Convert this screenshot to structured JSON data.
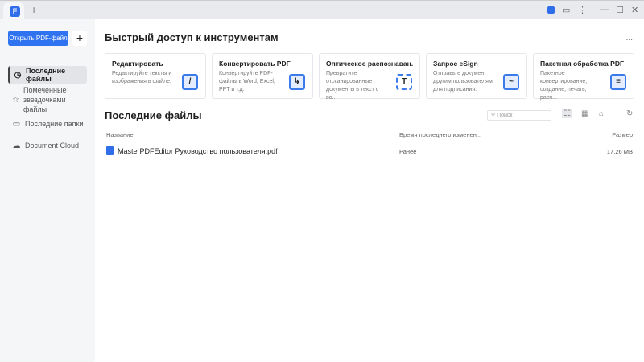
{
  "titlebar": {
    "plus": "+",
    "min": "—",
    "max": "☐",
    "close": "✕",
    "menu": "⋮"
  },
  "sidebar": {
    "open_button": "Открыть PDF-файл",
    "add": "+",
    "items": [
      {
        "label": "Последние файлы",
        "icon": "clock-icon"
      },
      {
        "label": "Помеченные звездочками файлы",
        "icon": "star-icon"
      },
      {
        "label": "Последние папки",
        "icon": "folder-icon"
      },
      {
        "label": "Document Cloud",
        "icon": "cloud-icon"
      }
    ]
  },
  "main": {
    "quick_title": "Быстрый доступ к инструментам",
    "more": "...",
    "cards": [
      {
        "title": "Редактировать",
        "desc": "Редактируйте тексты и изображения в файле."
      },
      {
        "title": "Конвертировать PDF",
        "desc": "Конвертируйте PDF-файлы в Word, Excel, PPT и т.д."
      },
      {
        "title": "Оптическое распознаван...",
        "desc": "Превратите отсканированные документы в текст с во..."
      },
      {
        "title": "Запрос eSign",
        "desc": "Отправьте документ другим пользователям для подписания."
      },
      {
        "title": "Пакетная обработка PDF",
        "desc": "Пакетное конвертирование, создание, печать, расп..."
      }
    ],
    "recent_title": "Последние файлы",
    "search_placeholder": "Поиск",
    "columns": {
      "name": "Название",
      "modified": "Время последнего изменен...",
      "size": "Размер"
    },
    "files": [
      {
        "name": "MasterPDFEditor Руководство пользователя.pdf",
        "modified": "Ранее",
        "size": "17,26 MB"
      }
    ]
  }
}
